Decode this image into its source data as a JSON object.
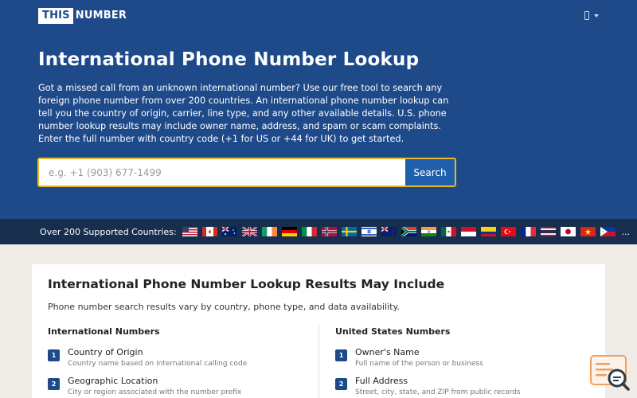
{
  "header": {
    "logo": {
      "part1": "THIS",
      "part2": "NUMBER"
    },
    "user_menu_icon": "user-icon"
  },
  "hero": {
    "title": "International Phone Number Lookup",
    "description": "Got a missed call from an unknown international number? Use our free tool to search any foreign phone number from over 200 countries. An international phone number lookup can tell you the country of origin, carrier, line type, and any other available details. U.S. phone number lookup results may include owner name, address, and spam or scam complaints. Enter the full number with country code (+1 for US or +44 for UK) to get started."
  },
  "search": {
    "placeholder": "e.g. +1 (903) 677-1499",
    "value": "",
    "button_label": "Search"
  },
  "countries": {
    "label": "Over 200 Supported Countries:",
    "flags": [
      "united-states",
      "canada",
      "australia",
      "united-kingdom",
      "ireland",
      "germany",
      "italy",
      "norway",
      "sweden",
      "israel",
      "new-zealand",
      "south-africa",
      "india",
      "mexico",
      "indonesia",
      "colombia",
      "turkey",
      "france",
      "thailand",
      "japan",
      "vietnam",
      "philippines"
    ],
    "more": "..."
  },
  "results": {
    "title": "International Phone Number Lookup Results May Include",
    "subtitle": "Phone number search results vary by country, phone type, and data availability.",
    "international": {
      "heading": "International Numbers",
      "items": [
        {
          "num": "1",
          "title": "Country of Origin",
          "desc": "Country name based on international calling code"
        },
        {
          "num": "2",
          "title": "Geographic Location",
          "desc": "City or region associated with the number prefix"
        }
      ]
    },
    "us": {
      "heading": "United States Numbers",
      "items": [
        {
          "num": "1",
          "title": "Owner's Name",
          "desc": "Full name of the person or business"
        },
        {
          "num": "2",
          "title": "Full Address",
          "desc": "Street, city, state, and ZIP from public records"
        }
      ]
    }
  },
  "chat_widget_icon": "chat-search-icon",
  "colors": {
    "hero_background": "#1e4a8a",
    "countries_bar": "#172e4e",
    "search_border": "#e8b923",
    "search_button": "#1f5fae",
    "page_background": "#efebe6",
    "widget_accent": "#f0a060"
  }
}
